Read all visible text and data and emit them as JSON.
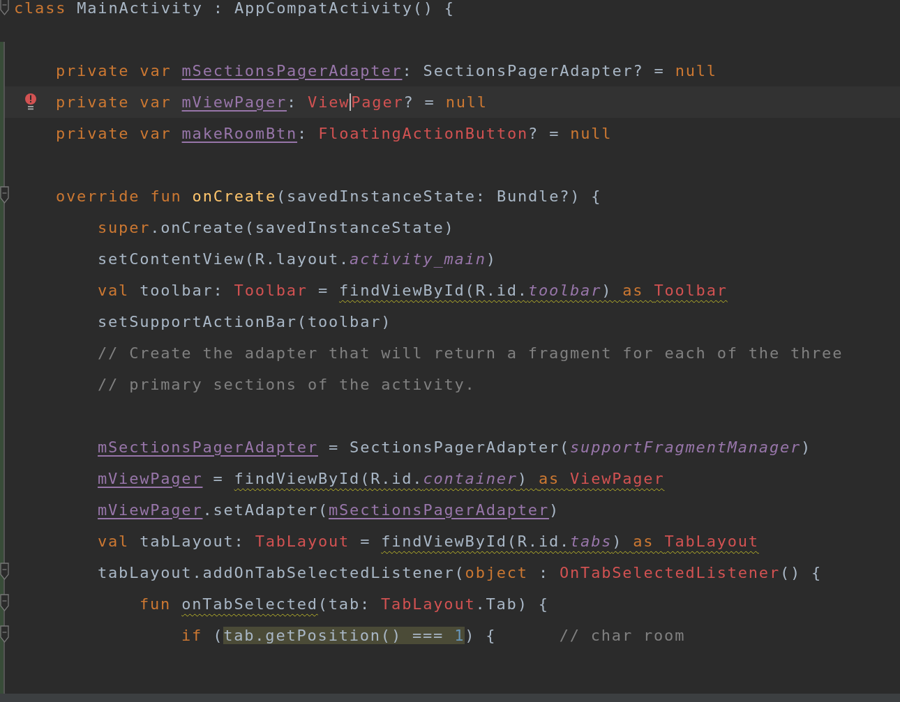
{
  "editor": {
    "lines": [
      {
        "kind": "code",
        "fold": true,
        "tokens": [
          {
            "text": "class ",
            "kind": "keyword"
          },
          {
            "text": "MainActivity : AppCompatActivity() {",
            "kind": "plain"
          }
        ]
      },
      {
        "kind": "blank"
      },
      {
        "kind": "code",
        "tokens": [
          {
            "text": "private var ",
            "kind": "keyword"
          },
          {
            "text": "mSectionsPagerAdapter",
            "kind": "field"
          },
          {
            "text": ": SectionsPagerAdapter? = ",
            "kind": "plain"
          },
          {
            "text": "null",
            "kind": "keyword"
          }
        ]
      },
      {
        "kind": "code",
        "current": true,
        "error": true,
        "tokens": [
          {
            "text": "private var ",
            "kind": "keyword"
          },
          {
            "text": "mViewPager",
            "kind": "field"
          },
          {
            "text": ": ",
            "kind": "plain"
          },
          {
            "text": "View",
            "kind": "unresolved"
          },
          {
            "text": "Pager",
            "kind": "unresolved",
            "caret": true
          },
          {
            "text": "? = ",
            "kind": "plain"
          },
          {
            "text": "null",
            "kind": "keyword"
          }
        ]
      },
      {
        "kind": "code",
        "tokens": [
          {
            "text": "private var ",
            "kind": "keyword"
          },
          {
            "text": "makeRoomBtn",
            "kind": "field"
          },
          {
            "text": ": ",
            "kind": "plain"
          },
          {
            "text": "FloatingActionButton",
            "kind": "unresolved"
          },
          {
            "text": "? = ",
            "kind": "plain"
          },
          {
            "text": "null",
            "kind": "keyword"
          }
        ]
      },
      {
        "kind": "blank"
      },
      {
        "kind": "code",
        "fold": true,
        "tokens": [
          {
            "text": "override fun ",
            "kind": "keyword"
          },
          {
            "text": "onCreate",
            "kind": "declaration"
          },
          {
            "text": "(savedInstanceState: Bundle?) {",
            "kind": "plain"
          }
        ]
      },
      {
        "kind": "code",
        "tokens": [
          {
            "text": "super",
            "kind": "keyword"
          },
          {
            "text": ".onCreate(savedInstanceState)",
            "kind": "plain"
          }
        ]
      },
      {
        "kind": "code",
        "tokens": [
          {
            "text": "setContentView(R.layout.",
            "kind": "plain"
          },
          {
            "text": "activity_main",
            "kind": "constant"
          },
          {
            "text": ")",
            "kind": "plain"
          }
        ]
      },
      {
        "kind": "code",
        "tokens": [
          {
            "text": "val ",
            "kind": "keyword"
          },
          {
            "text": "toolbar: ",
            "kind": "plain"
          },
          {
            "text": "Toolbar",
            "kind": "unresolved"
          },
          {
            "text": " = ",
            "kind": "plain"
          },
          {
            "text": "findViewById(R.id.",
            "kind": "plain",
            "warning": true
          },
          {
            "text": "toolbar",
            "kind": "constant",
            "warning": true
          },
          {
            "text": ") ",
            "kind": "plain",
            "warning": true
          },
          {
            "text": "as ",
            "kind": "keyword",
            "warning": true
          },
          {
            "text": "Toolbar",
            "kind": "unresolved",
            "warning": true
          }
        ]
      },
      {
        "kind": "code",
        "tokens": [
          {
            "text": "setSupportActionBar(toolbar)",
            "kind": "plain"
          }
        ]
      },
      {
        "kind": "code",
        "tokens": [
          {
            "text": "// Create the adapter that will return a fragment for each of the three",
            "kind": "comment"
          }
        ]
      },
      {
        "kind": "code",
        "tokens": [
          {
            "text": "// primary sections of the activity.",
            "kind": "comment"
          }
        ]
      },
      {
        "kind": "blank"
      },
      {
        "kind": "code",
        "tokens": [
          {
            "text": "mSectionsPagerAdapter",
            "kind": "field"
          },
          {
            "text": " = SectionsPagerAdapter(",
            "kind": "plain"
          },
          {
            "text": "supportFragmentManager",
            "kind": "constant"
          },
          {
            "text": ")",
            "kind": "plain"
          }
        ]
      },
      {
        "kind": "code",
        "tokens": [
          {
            "text": "mViewPager",
            "kind": "field"
          },
          {
            "text": " = ",
            "kind": "plain"
          },
          {
            "text": "findViewById(R.id.",
            "kind": "plain",
            "warning": true
          },
          {
            "text": "container",
            "kind": "constant",
            "warning": true
          },
          {
            "text": ") ",
            "kind": "plain",
            "warning": true
          },
          {
            "text": "as ",
            "kind": "keyword",
            "warning": true
          },
          {
            "text": "ViewPager",
            "kind": "unresolved",
            "warning": true
          }
        ]
      },
      {
        "kind": "code",
        "tokens": [
          {
            "text": "mViewPager",
            "kind": "field"
          },
          {
            "text": ".setAdapter(",
            "kind": "plain"
          },
          {
            "text": "mSectionsPagerAdapter",
            "kind": "field"
          },
          {
            "text": ")",
            "kind": "plain"
          }
        ]
      },
      {
        "kind": "code",
        "tokens": [
          {
            "text": "val ",
            "kind": "keyword"
          },
          {
            "text": "tabLayout: ",
            "kind": "plain"
          },
          {
            "text": "TabLayout",
            "kind": "unresolved"
          },
          {
            "text": " = ",
            "kind": "plain"
          },
          {
            "text": "findViewById(R.id.",
            "kind": "plain",
            "warning": true
          },
          {
            "text": "tabs",
            "kind": "constant",
            "warning": true
          },
          {
            "text": ") ",
            "kind": "plain",
            "warning": true
          },
          {
            "text": "as ",
            "kind": "keyword",
            "warning": true
          },
          {
            "text": "TabLayout",
            "kind": "unresolved",
            "warning": true
          }
        ]
      },
      {
        "kind": "code",
        "fold": true,
        "tokens": [
          {
            "text": "tabLayout.addOnTabSelectedListener(",
            "kind": "plain"
          },
          {
            "text": "object ",
            "kind": "keyword"
          },
          {
            "text": ": ",
            "kind": "plain"
          },
          {
            "text": "OnTabSelectedListener",
            "kind": "unresolved"
          },
          {
            "text": "() {",
            "kind": "plain"
          }
        ]
      },
      {
        "kind": "code",
        "fold": true,
        "tokens": [
          {
            "text": "fun ",
            "kind": "keyword"
          },
          {
            "text": "onTabSelected",
            "kind": "plain",
            "warning": true
          },
          {
            "text": "(tab: ",
            "kind": "plain"
          },
          {
            "text": "TabLayout",
            "kind": "unresolved"
          },
          {
            "text": ".Tab) {",
            "kind": "plain"
          }
        ]
      },
      {
        "kind": "code",
        "fold": true,
        "tokens": [
          {
            "text": "if ",
            "kind": "keyword"
          },
          {
            "text": "(",
            "kind": "plain"
          },
          {
            "text": "tab.getPosition() === ",
            "kind": "plain",
            "highlight": true
          },
          {
            "text": "1",
            "kind": "number",
            "highlight": true
          },
          {
            "text": ") {      ",
            "kind": "plain"
          },
          {
            "text": "// char room",
            "kind": "comment"
          }
        ]
      },
      {
        "kind": "blank"
      }
    ]
  }
}
